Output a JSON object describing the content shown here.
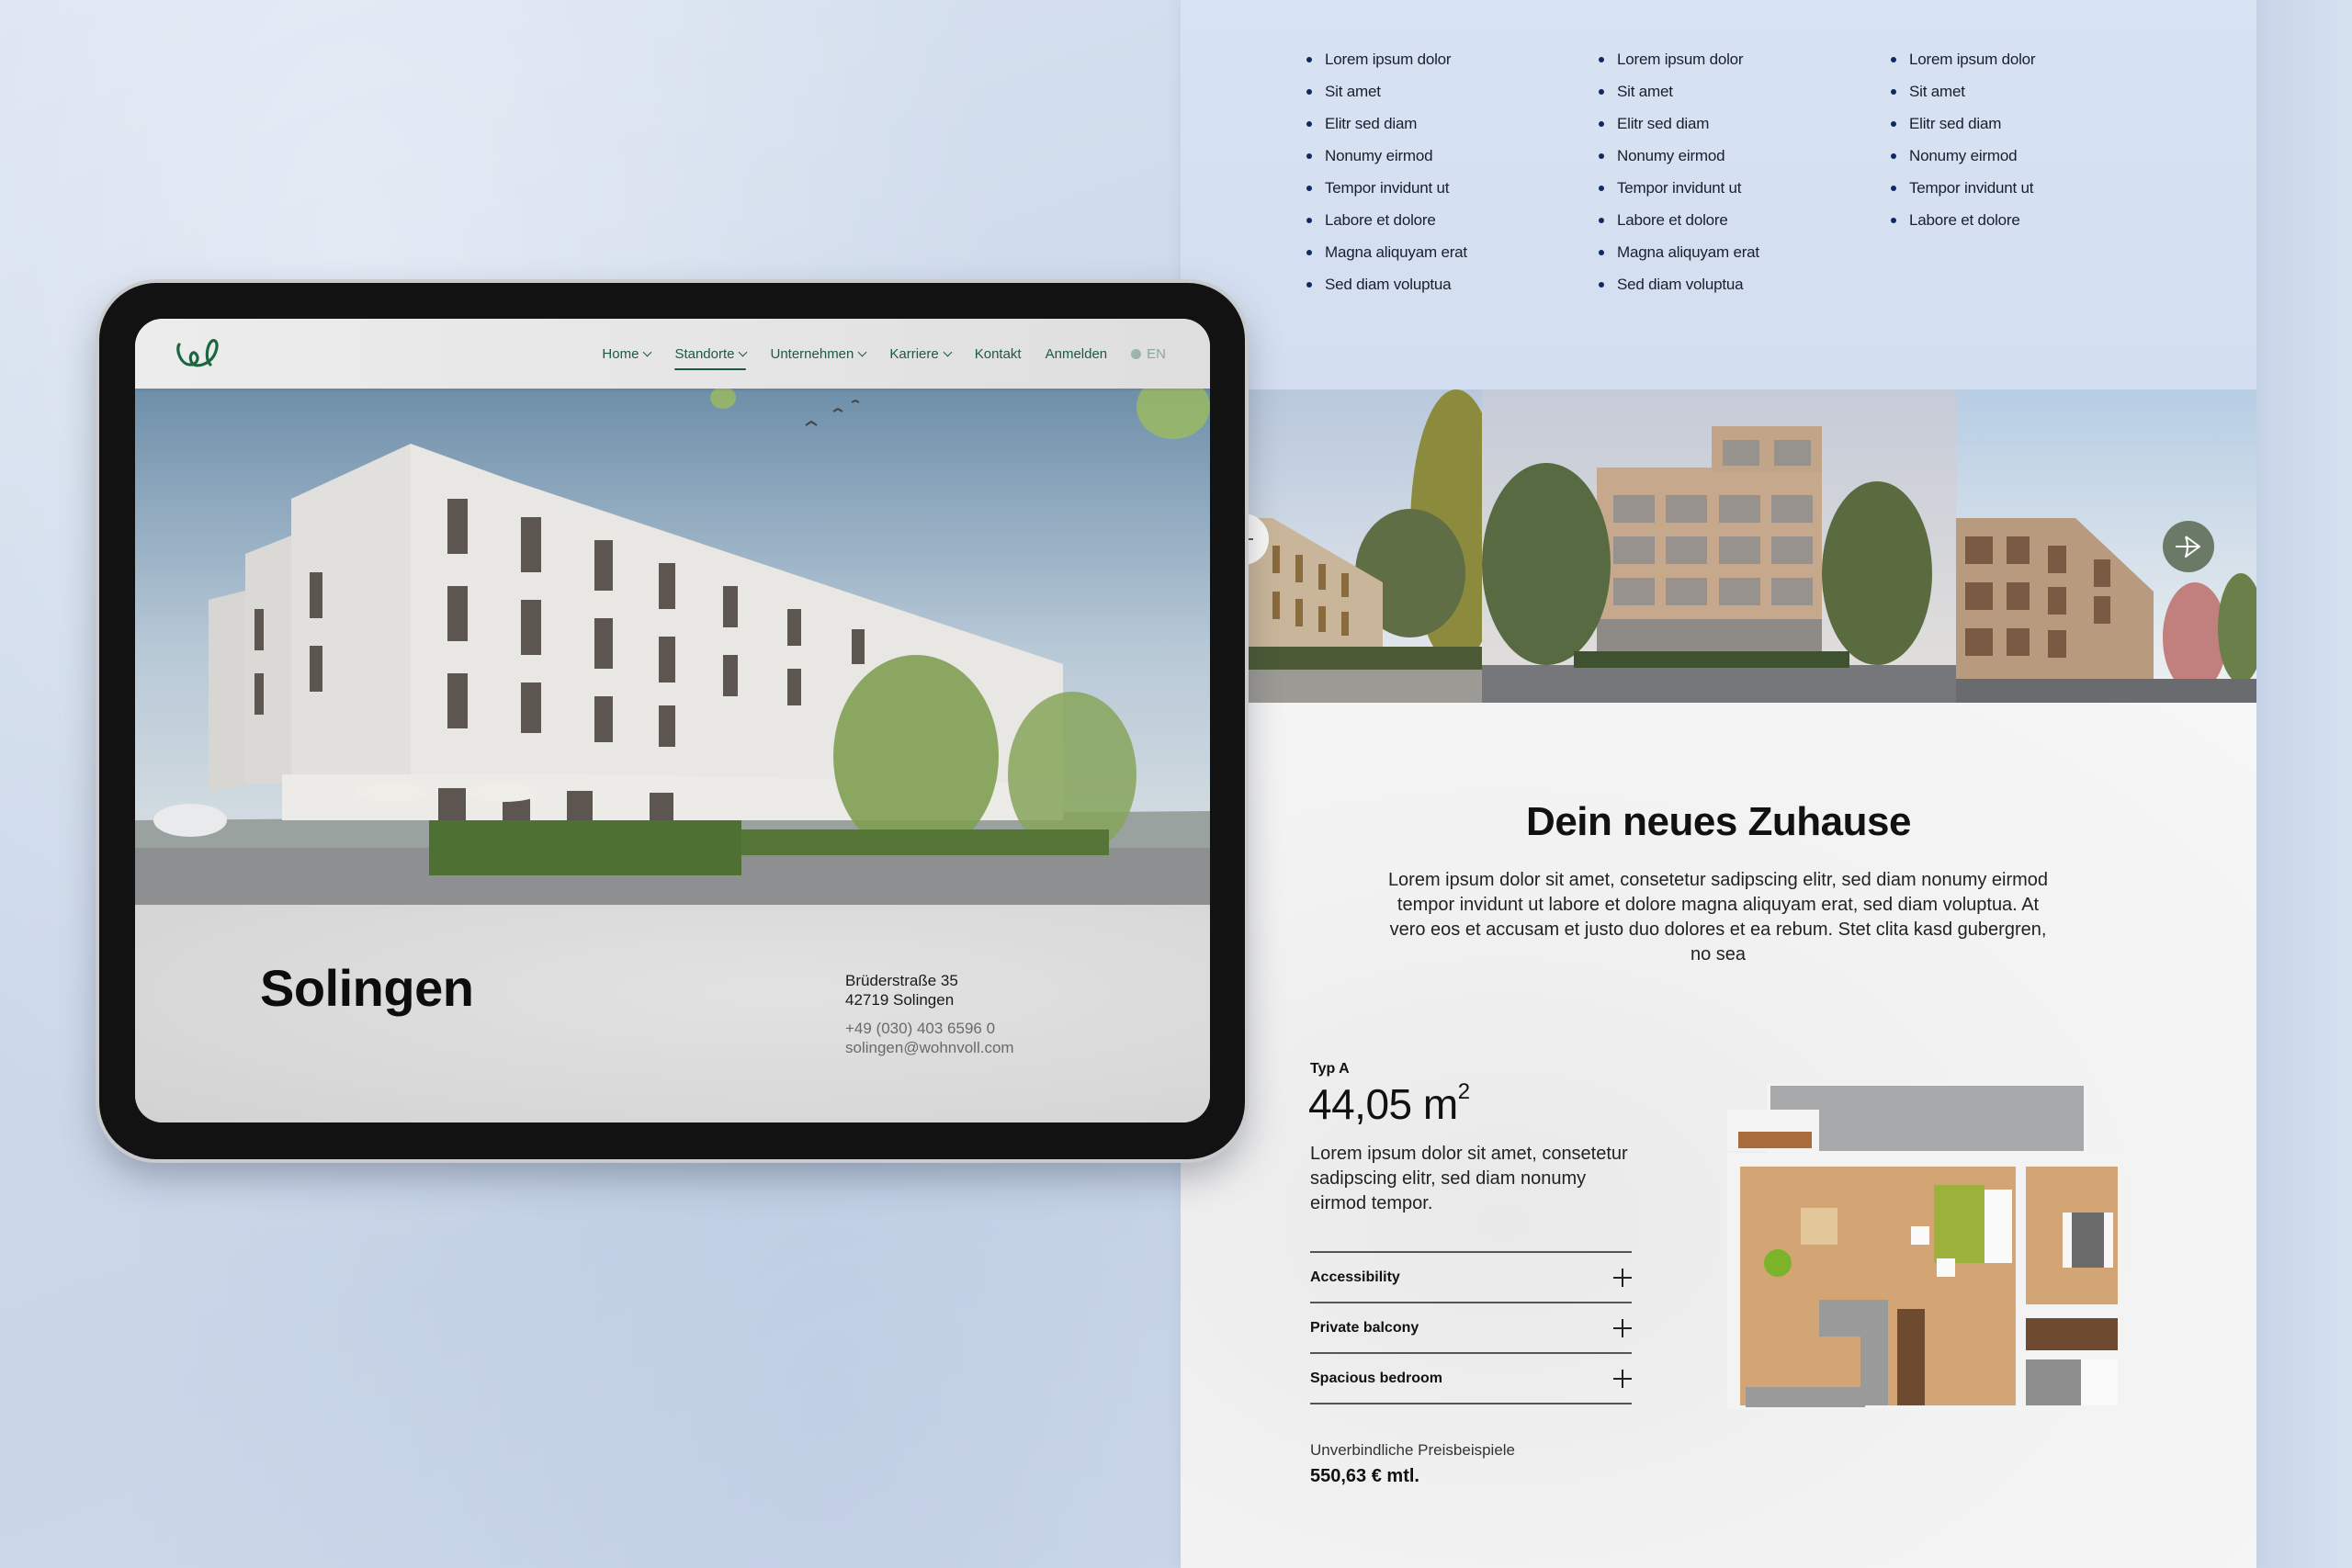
{
  "tablet": {
    "header": {
      "logo": "wohnvoll-logo",
      "nav": [
        {
          "label": "Home",
          "dropdown": true,
          "active": false
        },
        {
          "label": "Standorte",
          "dropdown": true,
          "active": true
        },
        {
          "label": "Unternehmen",
          "dropdown": true,
          "active": false
        },
        {
          "label": "Karriere",
          "dropdown": true,
          "active": false
        },
        {
          "label": "Kontakt",
          "dropdown": false,
          "active": false
        },
        {
          "label": "Anmelden",
          "dropdown": false,
          "active": false
        }
      ],
      "language": "EN"
    },
    "hero": {
      "image": "apartment-building-render"
    },
    "location": {
      "city": "Solingen",
      "street": "Brüderstraße 35",
      "zip_city": "42719 Solingen",
      "phone": "+49 (030) 403 6596 0",
      "email": "solingen@wohnvoll.com"
    }
  },
  "page": {
    "features": {
      "columns": [
        [
          "Lorem ipsum dolor",
          "Sit amet",
          "Elitr sed diam",
          "Nonumy eirmod",
          "Tempor invidunt ut",
          "Labore et dolore",
          "Magna aliquyam erat",
          "Sed diam voluptua"
        ],
        [
          "Lorem ipsum dolor",
          "Sit amet",
          "Elitr sed diam",
          "Nonumy eirmod",
          "Tempor invidunt ut",
          "Labore et dolore",
          "Magna aliquyam erat",
          "Sed diam voluptua"
        ],
        [
          "Lorem ipsum dolor",
          "Sit amet",
          "Elitr sed diam",
          "Nonumy eirmod",
          "Tempor invidunt ut",
          "Labore et dolore"
        ]
      ]
    },
    "carousel": {
      "slides": [
        "building-render-1",
        "building-render-2",
        "building-render-3"
      ]
    },
    "intro": {
      "title": "Dein neues Zuhause",
      "text": "Lorem ipsum dolor sit amet, consetetur sadipscing elitr, sed diam nonumy eirmod tempor invidunt ut labore et dolore magna aliquyam erat, sed diam voluptua. At vero eos et accusam et justo duo dolores et ea rebum. Stet clita kasd gubergren, no sea"
    },
    "unit": {
      "type": "Typ A",
      "area_value": "44,05 m",
      "area_unit_sup": "2",
      "description": "Lorem ipsum dolor sit amet, consetetur sadipscing elitr, sed diam nonumy eirmod tempor.",
      "accordion": [
        "Accessibility",
        "Private balcony",
        "Spacious bedroom"
      ],
      "price_label": "Unverbindliche Preisbeispiele",
      "price": "550,63 € mtl."
    }
  },
  "colors": {
    "brand_green": "#1e5a3e",
    "carousel_button": "#6b7a67",
    "bullet": "#0f2a62"
  }
}
